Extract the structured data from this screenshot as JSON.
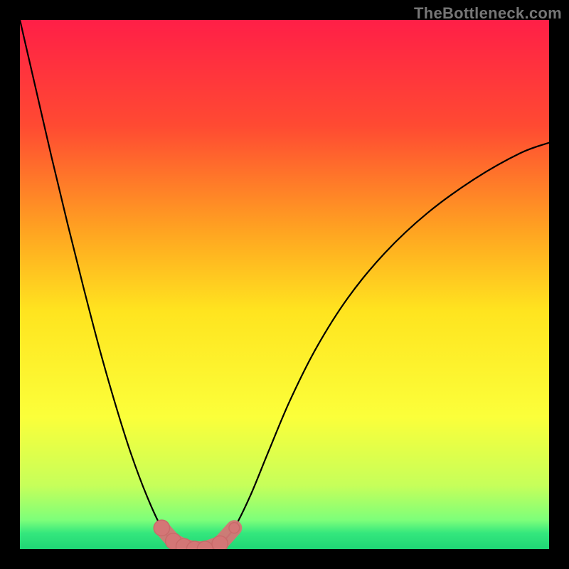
{
  "watermark": {
    "text": "TheBottleneck.com"
  },
  "colors": {
    "frame": "#000000",
    "watermark": "#767676",
    "curve": "#000000",
    "marker_fill": "#d47676",
    "marker_stroke": "#c96a6a",
    "gradient_stops": [
      {
        "offset": 0.0,
        "color": "#ff1f47"
      },
      {
        "offset": 0.2,
        "color": "#ff4a32"
      },
      {
        "offset": 0.4,
        "color": "#ffa421"
      },
      {
        "offset": 0.55,
        "color": "#ffe41f"
      },
      {
        "offset": 0.75,
        "color": "#fbff3a"
      },
      {
        "offset": 0.88,
        "color": "#c6ff5a"
      },
      {
        "offset": 0.945,
        "color": "#7dff7a"
      },
      {
        "offset": 0.97,
        "color": "#34e77d"
      },
      {
        "offset": 1.0,
        "color": "#1fd675"
      }
    ]
  },
  "chart_data": {
    "type": "line",
    "title": "",
    "xlabel": "",
    "ylabel": "",
    "xlim": [
      0,
      1
    ],
    "ylim": [
      0,
      1
    ],
    "series": [
      {
        "name": "bottleneck-curve",
        "x": [
          0.0,
          0.03,
          0.06,
          0.09,
          0.12,
          0.15,
          0.18,
          0.21,
          0.24,
          0.268,
          0.29,
          0.31,
          0.33,
          0.35,
          0.378,
          0.405,
          0.435,
          0.47,
          0.51,
          0.56,
          0.62,
          0.69,
          0.77,
          0.86,
          0.945,
          1.0
        ],
        "y": [
          1.0,
          0.87,
          0.74,
          0.615,
          0.495,
          0.38,
          0.275,
          0.18,
          0.1,
          0.04,
          0.015,
          0.005,
          0.0,
          0.0,
          0.01,
          0.04,
          0.1,
          0.185,
          0.28,
          0.38,
          0.475,
          0.56,
          0.635,
          0.7,
          0.748,
          0.768
        ]
      }
    ],
    "markers": {
      "name": "highlight-dots",
      "points": [
        {
          "x": 0.268,
          "y": 0.04,
          "r": 0.015
        },
        {
          "x": 0.29,
          "y": 0.015,
          "r": 0.015
        },
        {
          "x": 0.31,
          "y": 0.005,
          "r": 0.015
        },
        {
          "x": 0.33,
          "y": 0.0,
          "r": 0.015
        },
        {
          "x": 0.35,
          "y": 0.0,
          "r": 0.015
        },
        {
          "x": 0.378,
          "y": 0.01,
          "r": 0.015
        },
        {
          "x": 0.405,
          "y": 0.04,
          "r": 0.01
        }
      ]
    }
  }
}
